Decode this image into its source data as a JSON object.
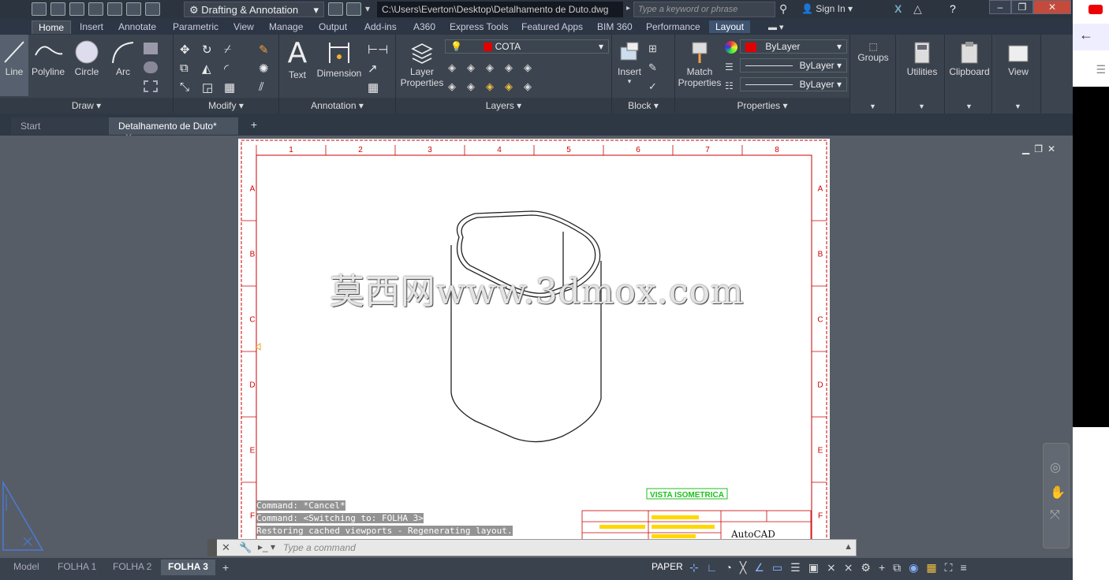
{
  "app": {
    "workspace": "Drafting & Annotation",
    "file_path": "C:\\Users\\Everton\\Desktop\\Detalhamento de Duto.dwg",
    "search_placeholder": "Type a keyword or phrase",
    "sign_in": "Sign In"
  },
  "ribbon_tabs": [
    "Home",
    "Insert",
    "Annotate",
    "Parametric",
    "View",
    "Manage",
    "Output",
    "Add-ins",
    "A360",
    "Express Tools",
    "Featured Apps",
    "BIM 360",
    "Performance",
    "Layout"
  ],
  "ribbon": {
    "draw": {
      "title": "Draw",
      "line": "Line",
      "polyline": "Polyline",
      "circle": "Circle",
      "arc": "Arc"
    },
    "modify": {
      "title": "Modify"
    },
    "annotation": {
      "title": "Annotation",
      "text": "Text",
      "dimension": "Dimension"
    },
    "layers": {
      "title": "Layers",
      "layer_properties_1": "Layer",
      "layer_properties_2": "Properties",
      "current_layer": "COTA"
    },
    "block": {
      "title": "Block",
      "insert": "Insert"
    },
    "properties": {
      "title": "Properties",
      "match_1": "Match",
      "match_2": "Properties",
      "color": "ByLayer",
      "linetype": "ByLayer",
      "lineweight": "ByLayer"
    },
    "groups": "Groups",
    "utilities": "Utilities",
    "clipboard": "Clipboard",
    "view": "View"
  },
  "doc_tabs": [
    "Start",
    "Detalhamento de Duto*"
  ],
  "drawing": {
    "col_labels": [
      "1",
      "2",
      "3",
      "4",
      "5",
      "6",
      "7",
      "8"
    ],
    "row_labels": [
      "A",
      "B",
      "C",
      "D",
      "E",
      "F"
    ],
    "view_title": "VISTA ISOMETRICA",
    "title_logo": "AutoCAD",
    "watermark": "莫西网www.3dmox.com"
  },
  "command": {
    "history": [
      "Command: *Cancel*",
      "Command:   <Switching to: FOLHA 3>",
      "Restoring cached viewports - Regenerating layout."
    ],
    "placeholder": "Type a command"
  },
  "layout_tabs": [
    "Model",
    "FOLHA 1",
    "FOLHA 2",
    "FOLHA 3"
  ],
  "status": {
    "space": "PAPER"
  },
  "colors": {
    "layer_color": "#e00000",
    "border_red": "#cc0000",
    "view_title": "#1fbf1f"
  }
}
